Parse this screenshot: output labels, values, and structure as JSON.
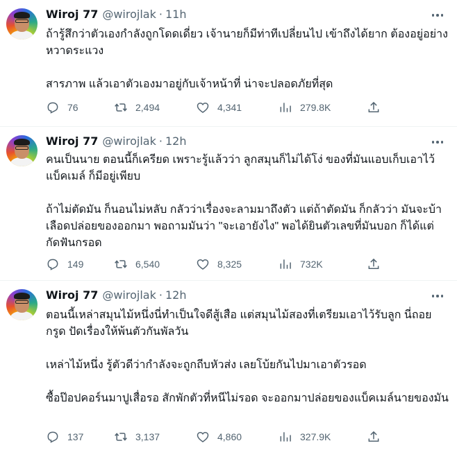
{
  "tweets": [
    {
      "name": "Wiroj 77",
      "handle": "@wirojlak",
      "separator": "·",
      "time": "11h",
      "paragraphs": [
        "ถ้ารู้สึกว่าตัวเองกำลังถูกโดดเดี่ยว เจ้านายก็มีท่าทีเปลี่ยนไป เข้าถึงได้ยาก ต้องอยู่อย่างหวาดระแวง",
        "สารภาพ แล้วเอาตัวเองมาอยู่กับเจ้าหน้าที่ น่าจะปลอดภัยที่สุด"
      ],
      "stats": {
        "replies": "76",
        "reposts": "2,494",
        "likes": "4,341",
        "views": "279.8K"
      }
    },
    {
      "name": "Wiroj 77",
      "handle": "@wirojlak",
      "separator": "·",
      "time": "12h",
      "paragraphs": [
        "คนเป็นนาย ตอนนี้ก็เครียด เพราะรู้แล้วว่า ลูกสมุนก็ไม่ได้โง่ ของที่มันแอบเก็บเอาไว้ แบ็คเมล์ ก็มีอยู่เพียบ",
        "ถ้าไม่ตัดมัน ก็นอนไม่หลับ กลัวว่าเรื่องจะลามมาถึงตัว แต่ถ้าตัดมัน ก็กลัวว่า มันจะบ้าเลือดปล่อยของออกมา พอถามมันว่า \"จะเอายังไง\" พอได้ยินตัวเลขที่มันบอก ก็ได้แต่กัดฟันกรอด"
      ],
      "stats": {
        "replies": "149",
        "reposts": "6,540",
        "likes": "8,325",
        "views": "732K"
      }
    },
    {
      "name": "Wiroj 77",
      "handle": "@wirojlak",
      "separator": "·",
      "time": "12h",
      "paragraphs": [
        "ตอนนี้เหล่าสมุนไม้หนึ่งนี่ทำเป็นใจดีสู้เสือ แต่สมุนไม้สองที่เตรียมเอาไว้รับลูก นี่ถอยกรูด ปัดเรื่องให้พ้นตัวกันพัลวัน",
        "เหล่าไม้หนึ่ง รู้ตัวดีว่ากำลังจะถูกถีบหัวส่ง เลยโบ้ยกันไปมาเอาตัวรอด",
        "ซื้อป๊อปคอร์นมาปูเสื่อรอ สักพักตัวที่หนีไม่รอด จะออกมาปล่อยของแบ็คเมล์นายของมัน"
      ],
      "stats": {
        "replies": "137",
        "reposts": "3,137",
        "likes": "4,860",
        "views": "327.9K"
      }
    }
  ],
  "icons": {
    "reply": "reply-icon",
    "repost": "repost-icon",
    "like": "like-icon",
    "views": "views-icon",
    "share": "share-icon",
    "more": "more-icon"
  }
}
